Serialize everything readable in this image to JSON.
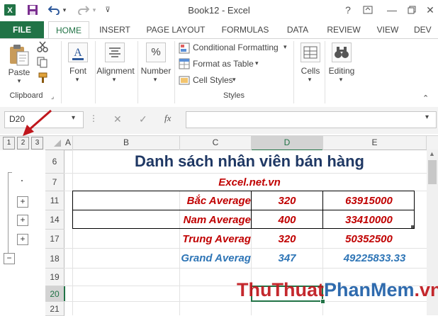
{
  "window": {
    "title": "Book12 - Excel",
    "help_icon": "?",
    "minimize_icon": "—",
    "close_icon": "✕"
  },
  "ribbon": {
    "tabs": [
      "FILE",
      "HOME",
      "INSERT",
      "PAGE LAYOUT",
      "FORMULAS",
      "DATA",
      "REVIEW",
      "VIEW",
      "DEV"
    ],
    "clipboard": {
      "paste": "Paste",
      "group": "Clipboard"
    },
    "font": {
      "label": "Font"
    },
    "alignment": {
      "label": "Alignment"
    },
    "number": {
      "label": "Number",
      "icon_text": "%"
    },
    "styles": {
      "conditional": "Conditional Formatting",
      "format_table": "Format as Table",
      "cell_styles": "Cell Styles",
      "group": "Styles"
    },
    "cells": {
      "label": "Cells"
    },
    "editing": {
      "label": "Editing"
    }
  },
  "formula_bar": {
    "name_box": "D20",
    "cancel_icon": "✕",
    "enter_icon": "✓",
    "fx": "fx",
    "value": ""
  },
  "outline": {
    "levels": [
      "1",
      "2",
      "3"
    ],
    "toggles": [
      "+",
      "+",
      "+",
      "−"
    ]
  },
  "columns": [
    "A",
    "B",
    "C",
    "D",
    "E"
  ],
  "rows": [
    "6",
    "7",
    "11",
    "14",
    "17",
    "18",
    "19",
    "20",
    "21"
  ],
  "sheet": {
    "title": "Danh sách nhân viên bán hàng",
    "subtitle": "Excel.net.vn",
    "data": [
      {
        "label": "Bắc Average",
        "d": "320",
        "e": "63915000"
      },
      {
        "label": "Nam Average",
        "d": "400",
        "e": "33410000"
      },
      {
        "label": "Trung Averag",
        "d": "320",
        "e": "50352500"
      },
      {
        "label": "Grand Averag",
        "d": "347",
        "e": "49225833.33"
      }
    ]
  },
  "watermark": {
    "part1": "ThuThuat",
    "part2": "PhanMem",
    "part3": ".vn"
  },
  "colors": {
    "excel_green": "#217346",
    "title_navy": "#1f3864",
    "red_text": "#c00000",
    "grand_blue": "#2e75b6",
    "arrow_red": "#c0161c"
  }
}
